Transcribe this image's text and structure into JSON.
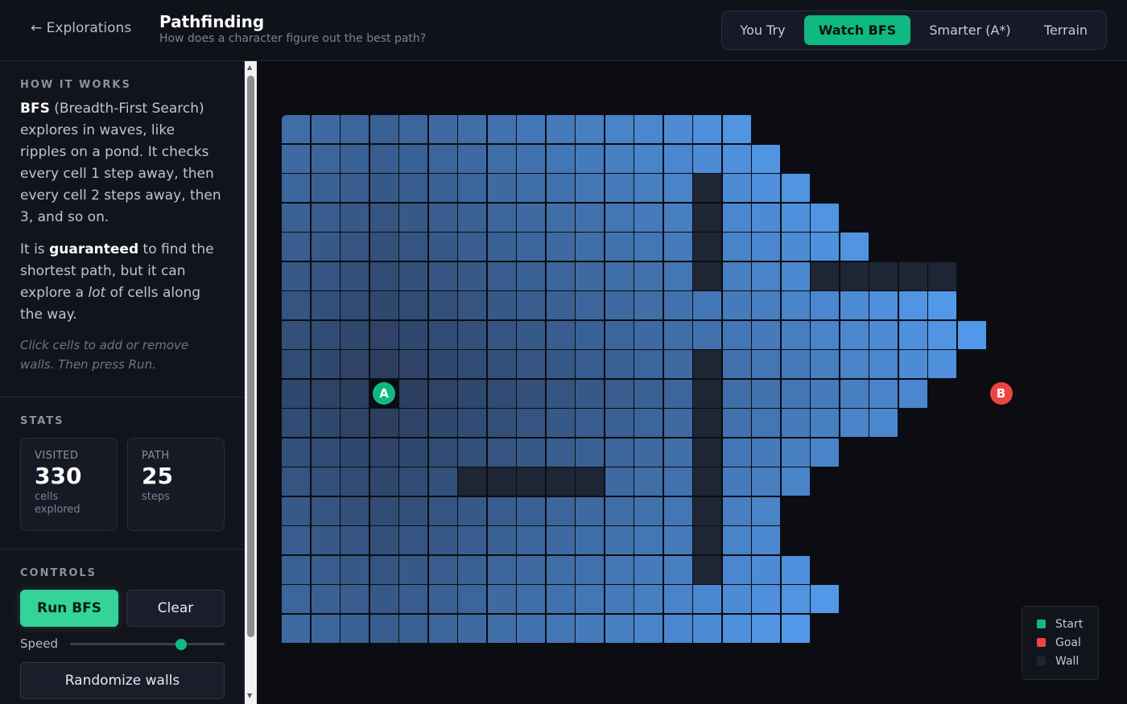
{
  "header": {
    "back_label": "← Explorations",
    "title": "Pathfinding",
    "subtitle": "How does a character figure out the best path?"
  },
  "tabs": [
    {
      "label": "You Try",
      "active": false
    },
    {
      "label": "Watch BFS",
      "active": true
    },
    {
      "label": "Smarter (A*)",
      "active": false
    },
    {
      "label": "Terrain",
      "active": false
    }
  ],
  "how_it_works": {
    "title": "HOW IT WORKS",
    "p1_bold": "BFS",
    "p1_rest": " (Breadth-First Search) explores in waves, like ripples on a pond. It checks every cell 1 step away, then every cell 2 steps away, then 3, and so on.",
    "p2_start": "It is ",
    "p2_bold": "guaranteed",
    "p2_mid": " to find the shortest path, but it can explore a ",
    "p2_italic": "lot",
    "p2_end": " of cells along the way.",
    "hint": "Click cells to add or remove walls. Then press Run."
  },
  "stats": {
    "title": "STATS",
    "visited": {
      "label": "VISITED",
      "value": "330",
      "unit": "cells explored"
    },
    "path": {
      "label": "PATH",
      "value": "25",
      "unit": "steps"
    }
  },
  "controls": {
    "title": "CONTROLS",
    "run_label": "Run BFS",
    "clear_label": "Clear",
    "speed_label": "Speed",
    "speed_value": 0.72,
    "randomize_label": "Randomize walls"
  },
  "grid": {
    "cols": 25,
    "rows": 18,
    "start": {
      "row": 9,
      "col": 3,
      "label": "A"
    },
    "goal": {
      "row": 9,
      "col": 24,
      "label": "B"
    },
    "visited_extent_per_row": [
      16,
      17,
      18,
      19,
      20,
      23,
      23,
      24,
      23,
      22,
      21,
      19,
      18,
      17,
      17,
      18,
      19,
      18
    ],
    "walls": [
      [
        2,
        14
      ],
      [
        3,
        14
      ],
      [
        4,
        14
      ],
      [
        5,
        14
      ],
      [
        8,
        14
      ],
      [
        9,
        14
      ],
      [
        10,
        14
      ],
      [
        11,
        14
      ],
      [
        12,
        14
      ],
      [
        13,
        14
      ],
      [
        14,
        14
      ],
      [
        15,
        14
      ],
      [
        5,
        18
      ],
      [
        5,
        19
      ],
      [
        5,
        20
      ],
      [
        5,
        21
      ],
      [
        5,
        22
      ],
      [
        12,
        6
      ],
      [
        12,
        7
      ],
      [
        12,
        8
      ],
      [
        12,
        9
      ],
      [
        12,
        10
      ]
    ]
  },
  "legend": [
    {
      "label": "Start",
      "color": "#10b981"
    },
    {
      "label": "Goal",
      "color": "#ef4444"
    },
    {
      "label": "Wall",
      "color": "#1e2535"
    }
  ],
  "colors": {
    "accent": "#10b981",
    "goal": "#ef4444",
    "wall": "#1e2535",
    "visited_near": "#2a3b5a",
    "visited_far": "#5298e8"
  }
}
